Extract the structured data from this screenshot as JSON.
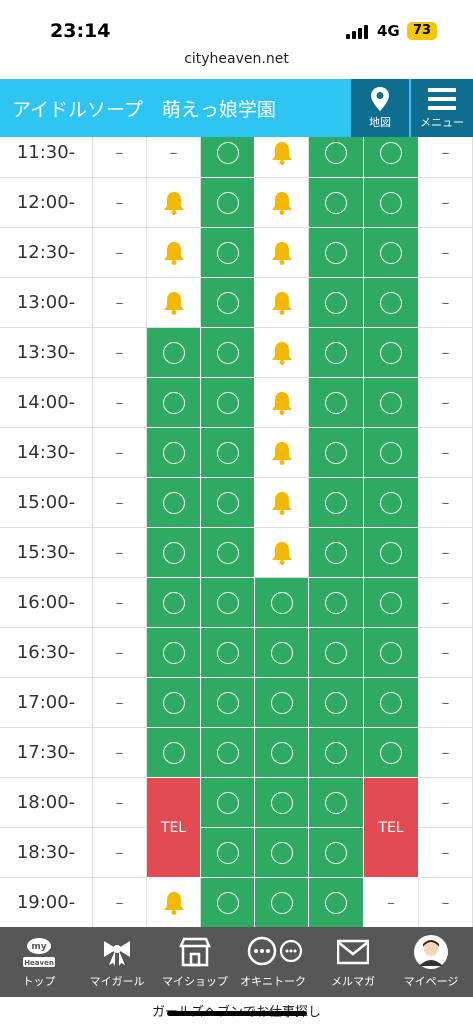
{
  "status_bar": {
    "time": "23:14",
    "network": "4G",
    "battery": "73"
  },
  "browser": {
    "url": "cityheaven.net"
  },
  "header": {
    "shop_name": "アイドルソープ　萌えっ娘学園",
    "map_label": "地図",
    "menu_label": "メニュー"
  },
  "schedule": {
    "legend": {
      "available": "circle",
      "few": "bell",
      "closed": "–",
      "tel": "TEL"
    },
    "rows": [
      {
        "time": "11:30-",
        "cells": [
          "–",
          "–",
          "circle",
          "bell",
          "circle",
          "circle",
          "–"
        ]
      },
      {
        "time": "12:00-",
        "cells": [
          "–",
          "bell",
          "circle",
          "bell",
          "circle",
          "circle",
          "–"
        ]
      },
      {
        "time": "12:30-",
        "cells": [
          "–",
          "bell",
          "circle",
          "bell",
          "circle",
          "circle",
          "–"
        ]
      },
      {
        "time": "13:00-",
        "cells": [
          "–",
          "bell",
          "circle",
          "bell",
          "circle",
          "circle",
          "–"
        ]
      },
      {
        "time": "13:30-",
        "cells": [
          "–",
          "circle",
          "circle",
          "bell",
          "circle",
          "circle",
          "–"
        ]
      },
      {
        "time": "14:00-",
        "cells": [
          "–",
          "circle",
          "circle",
          "bell",
          "circle",
          "circle",
          "–"
        ]
      },
      {
        "time": "14:30-",
        "cells": [
          "–",
          "circle",
          "circle",
          "bell",
          "circle",
          "circle",
          "–"
        ]
      },
      {
        "time": "15:00-",
        "cells": [
          "–",
          "circle",
          "circle",
          "bell",
          "circle",
          "circle",
          "–"
        ]
      },
      {
        "time": "15:30-",
        "cells": [
          "–",
          "circle",
          "circle",
          "bell",
          "circle",
          "circle",
          "–"
        ]
      },
      {
        "time": "16:00-",
        "cells": [
          "–",
          "circle",
          "circle",
          "circle",
          "circle",
          "circle",
          "–"
        ]
      },
      {
        "time": "16:30-",
        "cells": [
          "–",
          "circle",
          "circle",
          "circle",
          "circle",
          "circle",
          "–"
        ]
      },
      {
        "time": "17:00-",
        "cells": [
          "–",
          "circle",
          "circle",
          "circle",
          "circle",
          "circle",
          "–"
        ]
      },
      {
        "time": "17:30-",
        "cells": [
          "–",
          "circle",
          "circle",
          "circle",
          "circle",
          "circle",
          "–"
        ]
      },
      {
        "time": "18:00-",
        "cells": [
          "–",
          "tel",
          "circle",
          "circle",
          "circle",
          "tel",
          "–"
        ]
      },
      {
        "time": "18:30-",
        "cells": [
          "–",
          "tel",
          "circle",
          "circle",
          "circle",
          "tel",
          "–"
        ]
      },
      {
        "time": "19:00-",
        "cells": [
          "–",
          "bell",
          "circle",
          "circle",
          "circle",
          "–",
          "–"
        ]
      }
    ],
    "tel_label": "TEL"
  },
  "bottom_nav": [
    {
      "label": "トップ",
      "icon": "my-heaven-logo-icon",
      "logo_text": "my Heaven"
    },
    {
      "label": "マイガール",
      "icon": "ribbon-icon"
    },
    {
      "label": "マイショップ",
      "icon": "shop-icon"
    },
    {
      "label": "オキニトーク",
      "icon": "chat-bubbles-icon"
    },
    {
      "label": "メルマガ",
      "icon": "mail-icon"
    },
    {
      "label": "マイページ",
      "icon": "avatar-icon"
    }
  ],
  "bottom_banner": "ガールズヘブンでお仕事探し",
  "colors": {
    "header": "#2ec5f2",
    "header_button": "#0f6d8f",
    "available": "#2eaa62",
    "tel": "#e24b54",
    "nav": "#575757",
    "bell": "#f5b800"
  }
}
